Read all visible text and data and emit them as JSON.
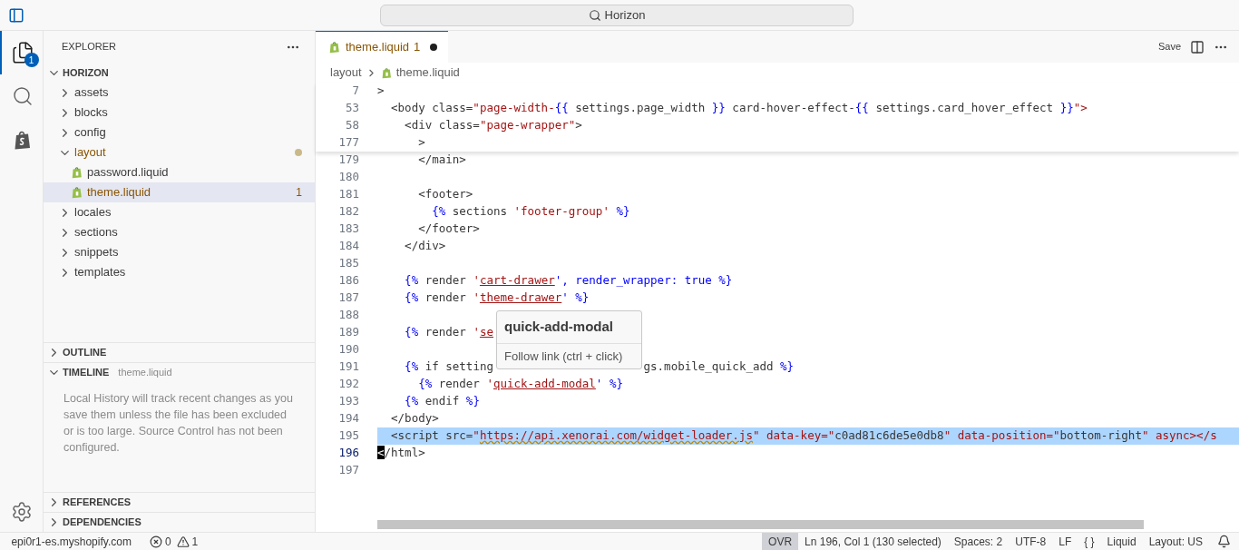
{
  "title_bar": {
    "search": "Horizon"
  },
  "activity_bar": [
    {
      "kind": "files",
      "selected": true,
      "badge": "1"
    },
    {
      "kind": "search",
      "selected": false
    },
    {
      "kind": "shopify",
      "selected": false
    }
  ],
  "sidebar": {
    "title": "EXPLORER",
    "root": {
      "label": "HORIZON",
      "expanded": true,
      "children": [
        {
          "label": "assets",
          "kind": "folder",
          "expanded": false,
          "selected": false,
          "modified": false
        },
        {
          "label": "blocks",
          "kind": "folder",
          "expanded": false,
          "selected": false,
          "modified": false
        },
        {
          "label": "config",
          "kind": "folder",
          "expanded": false,
          "selected": false,
          "modified": false
        },
        {
          "label": "layout",
          "kind": "folder",
          "expanded": true,
          "selected": false,
          "modified": true,
          "children": [
            {
              "label": "password.liquid",
              "kind": "file",
              "selected": false,
              "modified": false
            },
            {
              "label": "theme.liquid",
              "kind": "file",
              "selected": true,
              "modified": true,
              "badge": "1"
            }
          ]
        },
        {
          "label": "locales",
          "kind": "folder",
          "expanded": false,
          "selected": false,
          "modified": false
        },
        {
          "label": "sections",
          "kind": "folder",
          "expanded": false,
          "selected": false,
          "modified": false
        },
        {
          "label": "snippets",
          "kind": "folder",
          "expanded": false,
          "selected": false,
          "modified": false
        },
        {
          "label": "templates",
          "kind": "folder",
          "expanded": false,
          "selected": false,
          "modified": false
        }
      ]
    },
    "panels": [
      {
        "title": "OUTLINE",
        "expanded": false
      },
      {
        "title": "TIMELINE",
        "expanded": true,
        "subtitle": "theme.liquid",
        "message": "Local History will track recent changes as you save them unless the file has been excluded or is too large. Source Control has not been configured."
      },
      {
        "title": "REFERENCES",
        "expanded": false
      },
      {
        "title": "DEPENDENCIES",
        "expanded": false
      }
    ]
  },
  "editor": {
    "tabs": [
      {
        "label": "theme.liquid",
        "badge": "1",
        "dirty": true,
        "selected": true
      }
    ],
    "actions": {
      "save": "Save"
    },
    "breadcrumb": [
      "layout",
      "theme.liquid"
    ],
    "sticky_lines": [
      {
        "number": "7",
        "text": ">"
      },
      {
        "number": "53",
        "text": "  <body class=\"page-width-{{ settings.page_width }} card-hover-effect-{{ settings.card_hover_effect }}\">"
      },
      {
        "number": "58",
        "text": "    <div class=\"page-wrapper\">"
      },
      {
        "number": "177",
        "text": "      >"
      }
    ],
    "lines": [
      {
        "number": "179",
        "selected": false,
        "current": false,
        "text": "      </main>"
      },
      {
        "number": "180",
        "selected": false,
        "current": false
      },
      {
        "number": "181",
        "selected": false,
        "current": false,
        "text": "      <footer>"
      },
      {
        "number": "182",
        "selected": false,
        "current": false,
        "text": "        {% sections 'footer-group' %}"
      },
      {
        "number": "183",
        "selected": false,
        "current": false,
        "text": "      </footer>"
      },
      {
        "number": "184",
        "selected": false,
        "current": false,
        "text": "    </div>"
      },
      {
        "number": "185",
        "selected": false,
        "current": false
      },
      {
        "number": "186",
        "selected": false,
        "current": false,
        "text": "    {% render '",
        "link": {
          "text": "cart-drawer",
          "kind": "underline"
        },
        "after": "', render_wrapper: true %}"
      },
      {
        "number": "187",
        "selected": false,
        "current": false,
        "text": "    {% render '",
        "link": {
          "text": "theme-drawer",
          "kind": "underline"
        },
        "after": "' %}"
      },
      {
        "number": "188",
        "selected": false,
        "current": false
      },
      {
        "number": "189",
        "selected": false,
        "current": false,
        "text": "    {% render '",
        "link": {
          "text": "se",
          "kind": "underline"
        }
      },
      {
        "number": "190",
        "selected": false,
        "current": false
      },
      {
        "number": "191",
        "selected": false,
        "current": false,
        "text": "    {% if setting",
        "tail": "gs.mobile_quick_add %}"
      },
      {
        "number": "192",
        "selected": false,
        "current": false,
        "text": "      {% render '",
        "link": {
          "text": "quick-add-modal",
          "kind": "underline"
        },
        "after": "' %}"
      },
      {
        "number": "193",
        "selected": false,
        "current": false,
        "text": "    {% endif %}"
      },
      {
        "number": "194",
        "selected": false,
        "current": false,
        "text": "  </body>"
      },
      {
        "number": "195",
        "selected": true,
        "current": false,
        "text": "  <script src=\"",
        "link": {
          "text": "https://api.xenorai.com/widget-loader.js",
          "kind": "squiggle"
        },
        "after": "\" data-key=\"c0ad81c6de5e0db8\" data-position=\"bottom-right\" async></s"
      },
      {
        "number": "196",
        "selected": false,
        "current": true,
        "cursor": true,
        "text": "</html>"
      },
      {
        "number": "197",
        "selected": false,
        "current": false
      }
    ],
    "hover": {
      "title": "quick-add-modal",
      "body": "Follow link (ctrl + click)"
    }
  },
  "status_bar": {
    "remote": "epi0r1-es.myshopify.com",
    "errors": "0",
    "warnings": "1",
    "items": [
      {
        "text": "OVR",
        "selected": true
      },
      {
        "text": "Ln 196, Col 1 (130 selected)",
        "selected": false
      },
      {
        "text": "Spaces: 2",
        "selected": false
      },
      {
        "text": "UTF-8",
        "selected": false
      },
      {
        "text": "LF",
        "selected": false
      },
      {
        "text": "{ }",
        "selected": false
      },
      {
        "text": "Liquid",
        "selected": false
      },
      {
        "text": "Layout: US",
        "selected": false
      }
    ]
  }
}
